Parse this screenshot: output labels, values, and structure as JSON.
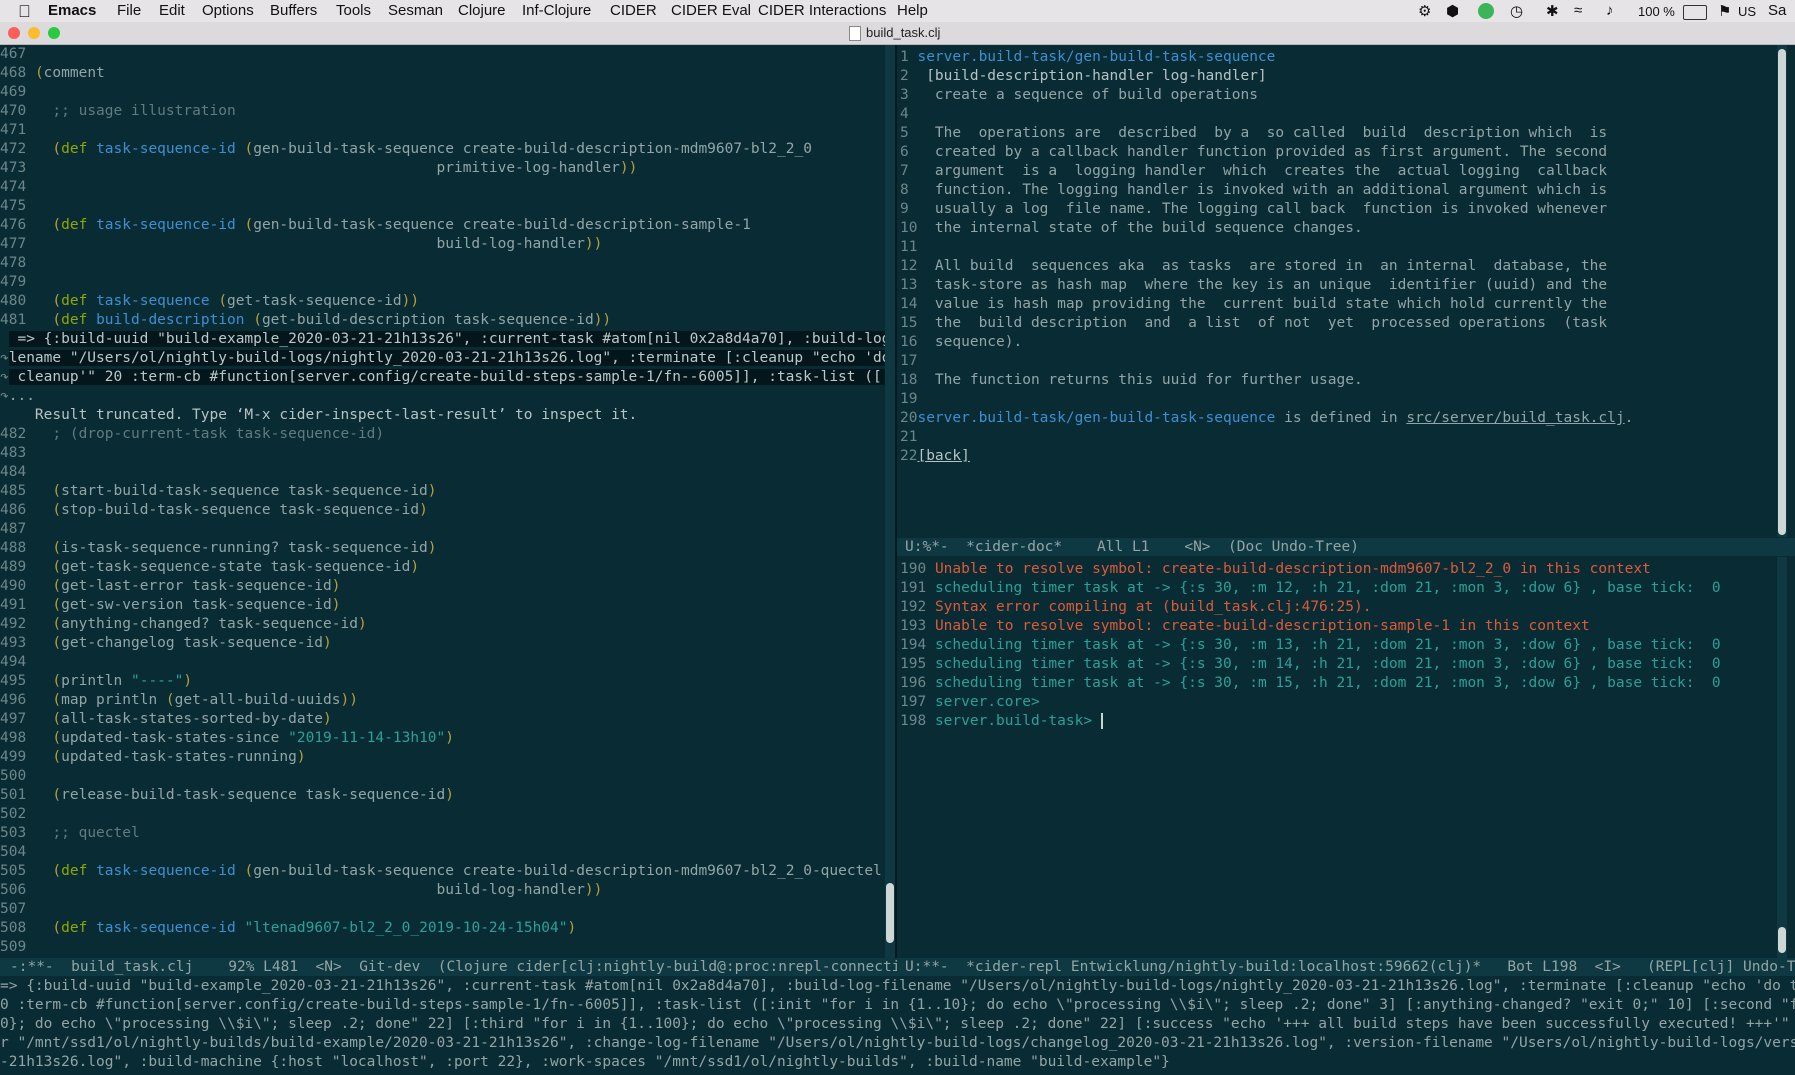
{
  "menubar": {
    "items": [
      "Emacs",
      "File",
      "Edit",
      "Options",
      "Buffers",
      "Tools",
      "Sesman",
      "Clojure",
      "Inf-Clojure",
      "CIDER",
      "CIDER Eval",
      "CIDER Interactions",
      "Help"
    ],
    "battery": "100 %",
    "input": "US",
    "user": "Sa"
  },
  "window": {
    "title": "build_task.clj"
  },
  "left_buffer": {
    "lines": [
      {
        "n": "467",
        "t": ""
      },
      {
        "n": "468",
        "t": "(comment"
      },
      {
        "n": "469",
        "t": ""
      },
      {
        "n": "470",
        "t": "  ;; usage illustration"
      },
      {
        "n": "471",
        "t": ""
      },
      {
        "n": "472",
        "t": "  (def task-sequence-id (gen-build-task-sequence create-build-description-mdm9607-bl2_2_0"
      },
      {
        "n": "473",
        "t": "                                              primitive-log-handler))"
      },
      {
        "n": "474",
        "t": ""
      },
      {
        "n": "475",
        "t": ""
      },
      {
        "n": "476",
        "t": "  (def task-sequence-id (gen-build-task-sequence create-build-description-sample-1"
      },
      {
        "n": "477",
        "t": "                                              build-log-handler))"
      },
      {
        "n": "478",
        "t": ""
      },
      {
        "n": "479",
        "t": ""
      },
      {
        "n": "480",
        "t": "  (def task-sequence (get-task-sequence-id))"
      },
      {
        "n": "481",
        "t": "  (def build-description (get-build-description task-sequence-id))"
      }
    ],
    "overlay": [
      " => {:build-uuid \"build-example_2020-03-21-21h13s26\", :current-task #atom[nil 0x2a8d4a70], :build-log-fi",
      "lename \"/Users/ol/nightly-build-logs/nightly_2020-03-21-21h13s26.log\", :terminate [:cleanup \"echo 'do the",
      " cleanup'\" 20 :term-cb #function[server.config/create-build-steps-sample-1/fn--6005]], :task-list ([:ini"
    ],
    "ellipsis": "...",
    "truncated_msg": "Result truncated. Type ‘M-x cider-inspect-last-result’ to inspect it.",
    "lines2": [
      {
        "n": "482",
        "t": "  ; (drop-current-task task-sequence-id)"
      },
      {
        "n": "483",
        "t": ""
      },
      {
        "n": "484",
        "t": ""
      },
      {
        "n": "485",
        "t": "  (start-build-task-sequence task-sequence-id)"
      },
      {
        "n": "486",
        "t": "  (stop-build-task-sequence task-sequence-id)"
      },
      {
        "n": "487",
        "t": ""
      },
      {
        "n": "488",
        "t": "  (is-task-sequence-running? task-sequence-id)"
      },
      {
        "n": "489",
        "t": "  (get-task-sequence-state task-sequence-id)"
      },
      {
        "n": "490",
        "t": "  (get-last-error task-sequence-id)"
      },
      {
        "n": "491",
        "t": "  (get-sw-version task-sequence-id)"
      },
      {
        "n": "492",
        "t": "  (anything-changed? task-sequence-id)"
      },
      {
        "n": "493",
        "t": "  (get-changelog task-sequence-id)"
      },
      {
        "n": "494",
        "t": ""
      },
      {
        "n": "495",
        "t": "  (println \"----\")"
      },
      {
        "n": "496",
        "t": "  (map println (get-all-build-uuids))"
      },
      {
        "n": "497",
        "t": "  (all-task-states-sorted-by-date)"
      },
      {
        "n": "498",
        "t": "  (updated-task-states-since \"2019-11-14-13h10\")"
      },
      {
        "n": "499",
        "t": "  (updated-task-states-running)"
      },
      {
        "n": "500",
        "t": ""
      },
      {
        "n": "501",
        "t": "  (release-build-task-sequence task-sequence-id)"
      },
      {
        "n": "502",
        "t": ""
      },
      {
        "n": "503",
        "t": "  ;; quectel"
      },
      {
        "n": "504",
        "t": ""
      },
      {
        "n": "505",
        "t": "  (def task-sequence-id (gen-build-task-sequence create-build-description-mdm9607-bl2_2_0-quectel"
      },
      {
        "n": "506",
        "t": "                                              build-log-handler))"
      },
      {
        "n": "507",
        "t": ""
      },
      {
        "n": "508",
        "t": "  (def task-sequence-id \"ltenad9607-bl2_2_0_2019-10-24-15h04\")"
      },
      {
        "n": "509",
        "t": ""
      }
    ],
    "modeline": "-:**-  build_task.clj    92% L481  <N>  Git-dev  (Clojure cider[clj:nightly-build@:proc:nrepl-connection] ARev F"
  },
  "doc_buffer": {
    "lines": [
      {
        "n": "1",
        "t": "server.build-task/gen-build-task-sequence"
      },
      {
        "n": "2",
        "t": " [build-description-handler log-handler]"
      },
      {
        "n": "3",
        "t": "  create a sequence of build operations"
      },
      {
        "n": "4",
        "t": ""
      },
      {
        "n": "5",
        "t": "  The  operations are  described  by a  so called  build  description which  is"
      },
      {
        "n": "6",
        "t": "  created by a callback handler function provided as first argument. The second"
      },
      {
        "n": "7",
        "t": "  argument  is a  logging handler  which  creates the  actual logging  callback"
      },
      {
        "n": "8",
        "t": "  function. The logging handler is invoked with an additional argument which is"
      },
      {
        "n": "9",
        "t": "  usually a log  file name. The logging call back  function is invoked whenever"
      },
      {
        "n": "10",
        "t": "  the internal state of the build sequence changes."
      },
      {
        "n": "11",
        "t": ""
      },
      {
        "n": "12",
        "t": "  All build  sequences aka  as tasks  are stored in  an internal  database, the"
      },
      {
        "n": "13",
        "t": "  task-store as hash map  where the key is an unique  identifier (uuid) and the"
      },
      {
        "n": "14",
        "t": "  value is hash map providing the  current build state which hold currently the"
      },
      {
        "n": "15",
        "t": "  the  build description  and  a list  of not  yet  processed operations  (task"
      },
      {
        "n": "16",
        "t": "  sequence)."
      },
      {
        "n": "17",
        "t": ""
      },
      {
        "n": "18",
        "t": "  The function returns this uuid for further usage."
      },
      {
        "n": "19",
        "t": ""
      },
      {
        "n": "20",
        "t": "server.build-task/gen-build-task-sequence is defined in src/server/build_task.clj."
      },
      {
        "n": "21",
        "t": ""
      },
      {
        "n": "22",
        "t": "[back]"
      }
    ],
    "modeline": "U:%*-  *cider-doc*    All L1    <N>  (Doc Undo-Tree)"
  },
  "repl_buffer": {
    "lines": [
      {
        "n": "190",
        "t": "Unable to resolve symbol: create-build-description-mdm9607-bl2_2_0 in this context",
        "k": "err"
      },
      {
        "n": "191",
        "t": "scheduling timer task at -> {:s 30, :m 12, :h 21, :dom 21, :mon 3, :dow 6} , base tick:  0",
        "k": "ok"
      },
      {
        "n": "192",
        "t": "Syntax error compiling at (build_task.clj:476:25).",
        "k": "err"
      },
      {
        "n": "193",
        "t": "Unable to resolve symbol: create-build-description-sample-1 in this context",
        "k": "err"
      },
      {
        "n": "194",
        "t": "scheduling timer task at -> {:s 30, :m 13, :h 21, :dom 21, :mon 3, :dow 6} , base tick:  0",
        "k": "ok"
      },
      {
        "n": "195",
        "t": "scheduling timer task at -> {:s 30, :m 14, :h 21, :dom 21, :mon 3, :dow 6} , base tick:  0",
        "k": "ok"
      },
      {
        "n": "196",
        "t": "scheduling timer task at -> {:s 30, :m 15, :h 21, :dom 21, :mon 3, :dow 6} , base tick:  0",
        "k": "ok"
      },
      {
        "n": "197",
        "t": "server.core>",
        "k": "ok"
      },
      {
        "n": "198",
        "t": "server.build-task> ",
        "k": "ok"
      }
    ],
    "modeline": "U:**-  *cider-repl Entwicklung/nightly-build:localhost:59662(clj)*   Bot L198  <I>   (REPL[clj] Undo-Tree ElDoc"
  },
  "echo_area": [
    "=> {:build-uuid \"build-example_2020-03-21-21h13s26\", :current-task #atom[nil 0x2a8d4a70], :build-log-filename \"/Users/ol/nightly-build-logs/nightly_2020-03-21-21h13s26.log\", :terminate [:cleanup \"echo 'do the cleanup'\" 2",
    "0 :term-cb #function[server.config/create-build-steps-sample-1/fn--6005]], :task-list ([:init \"for i in {1..10}; do echo \\\"processing \\\\$i\\\"; sleep .2; done\" 3] [:anything-changed? \"exit 0;\" 10] [:second \"for i in {1..10",
    "0}; do echo \\\"processing \\\\$i\\\"; sleep .2; done\" 22] [:third \"for i in {1..100}; do echo \\\"processing \\\\$i\\\"; sleep .2; done\" 22] [:success \"echo '+++ all build steps have been successfully executed! +++'\" 3]), :build-di",
    "r \"/mnt/ssd1/ol/nightly-builds/build-example/2020-03-21-21h13s26\", :change-log-filename \"/Users/ol/nightly-build-logs/changelog_2020-03-21-21h13s26.log\", :version-filename \"/Users/ol/nightly-build-logs/version_2020-03-21",
    "-21h13s26.log\", :build-machine {:host \"localhost\", :port 22}, :work-spaces \"/mnt/ssd1/ol/nightly-builds\", :build-name \"build-example\"}"
  ],
  "colors": {
    "bg": "#092b34",
    "keyword": "#8fa800",
    "symbol": "#3d8fd1",
    "string": "#2aa198",
    "error": "#dc5a3a"
  }
}
